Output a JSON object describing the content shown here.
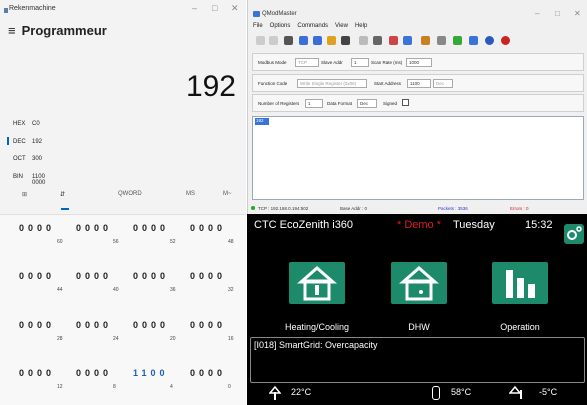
{
  "calc": {
    "app_title": "Rekenmachine",
    "mode_title": "Programmeur",
    "display": "192",
    "radix": [
      {
        "name": "HEX",
        "value": "C0"
      },
      {
        "name": "DEC",
        "value": "192"
      },
      {
        "name": "OCT",
        "value": "300"
      },
      {
        "name": "BIN",
        "value": "1100 0000"
      }
    ],
    "kb_tabs": {
      "qword": "QWORD",
      "ms": "MS",
      "mplus": "M~"
    },
    "bit_rows": [
      {
        "groups": [
          "0000",
          "0000",
          "0000",
          "0000"
        ],
        "positions": [
          "60",
          "56",
          "52",
          "48"
        ]
      },
      {
        "groups": [
          "0000",
          "0000",
          "0000",
          "0000"
        ],
        "positions": [
          "44",
          "40",
          "36",
          "32"
        ]
      },
      {
        "groups": [
          "0000",
          "0000",
          "0000",
          "0000"
        ],
        "positions": [
          "28",
          "24",
          "20",
          "16"
        ]
      },
      {
        "groups": [
          "0000",
          "0000",
          "1100",
          "0000"
        ],
        "positions": [
          "12",
          "8",
          "4",
          "0"
        ]
      }
    ]
  },
  "qm": {
    "title": "QModMaster",
    "menu": [
      "File",
      "Options",
      "Commands",
      "View",
      "Help"
    ],
    "modbus_mode_label": "Modbus Mode",
    "modbus_mode": "TCP",
    "slave_addr_label": "Slave Addr",
    "slave_addr": "1",
    "scan_rate_label": "Scan Rate (ms)",
    "scan_rate": "1000",
    "function_code_label": "Function Code",
    "function_code": "Write Single Register (0x06)",
    "start_address_label": "Start Address",
    "start_address": "1100",
    "start_fmt": "Dec",
    "num_registers_label": "Number of Registers",
    "num_registers": "1",
    "data_format_label": "Data Format",
    "data_format": "Dec",
    "signed_label": "Signed",
    "output_value": "192",
    "status": {
      "conn": "TCP : 192.168.0.194:502",
      "base_addr": "Base Addr : 0",
      "packets": "Packets : 3536",
      "errors": "Errors : 0"
    }
  },
  "ctc": {
    "device": "CTC EcoZenith i360",
    "demo": "* Demo *",
    "day": "Tuesday",
    "time": "15:32",
    "tiles": [
      "Heating/Cooling",
      "DHW",
      "Operation"
    ],
    "alarm": "[I018] SmartGrid: Overcapacity",
    "temps": [
      "22°C",
      "58°C",
      "-5°C"
    ],
    "colors": {
      "accent": "#1e8a6c",
      "demo": "#e01b24"
    }
  }
}
